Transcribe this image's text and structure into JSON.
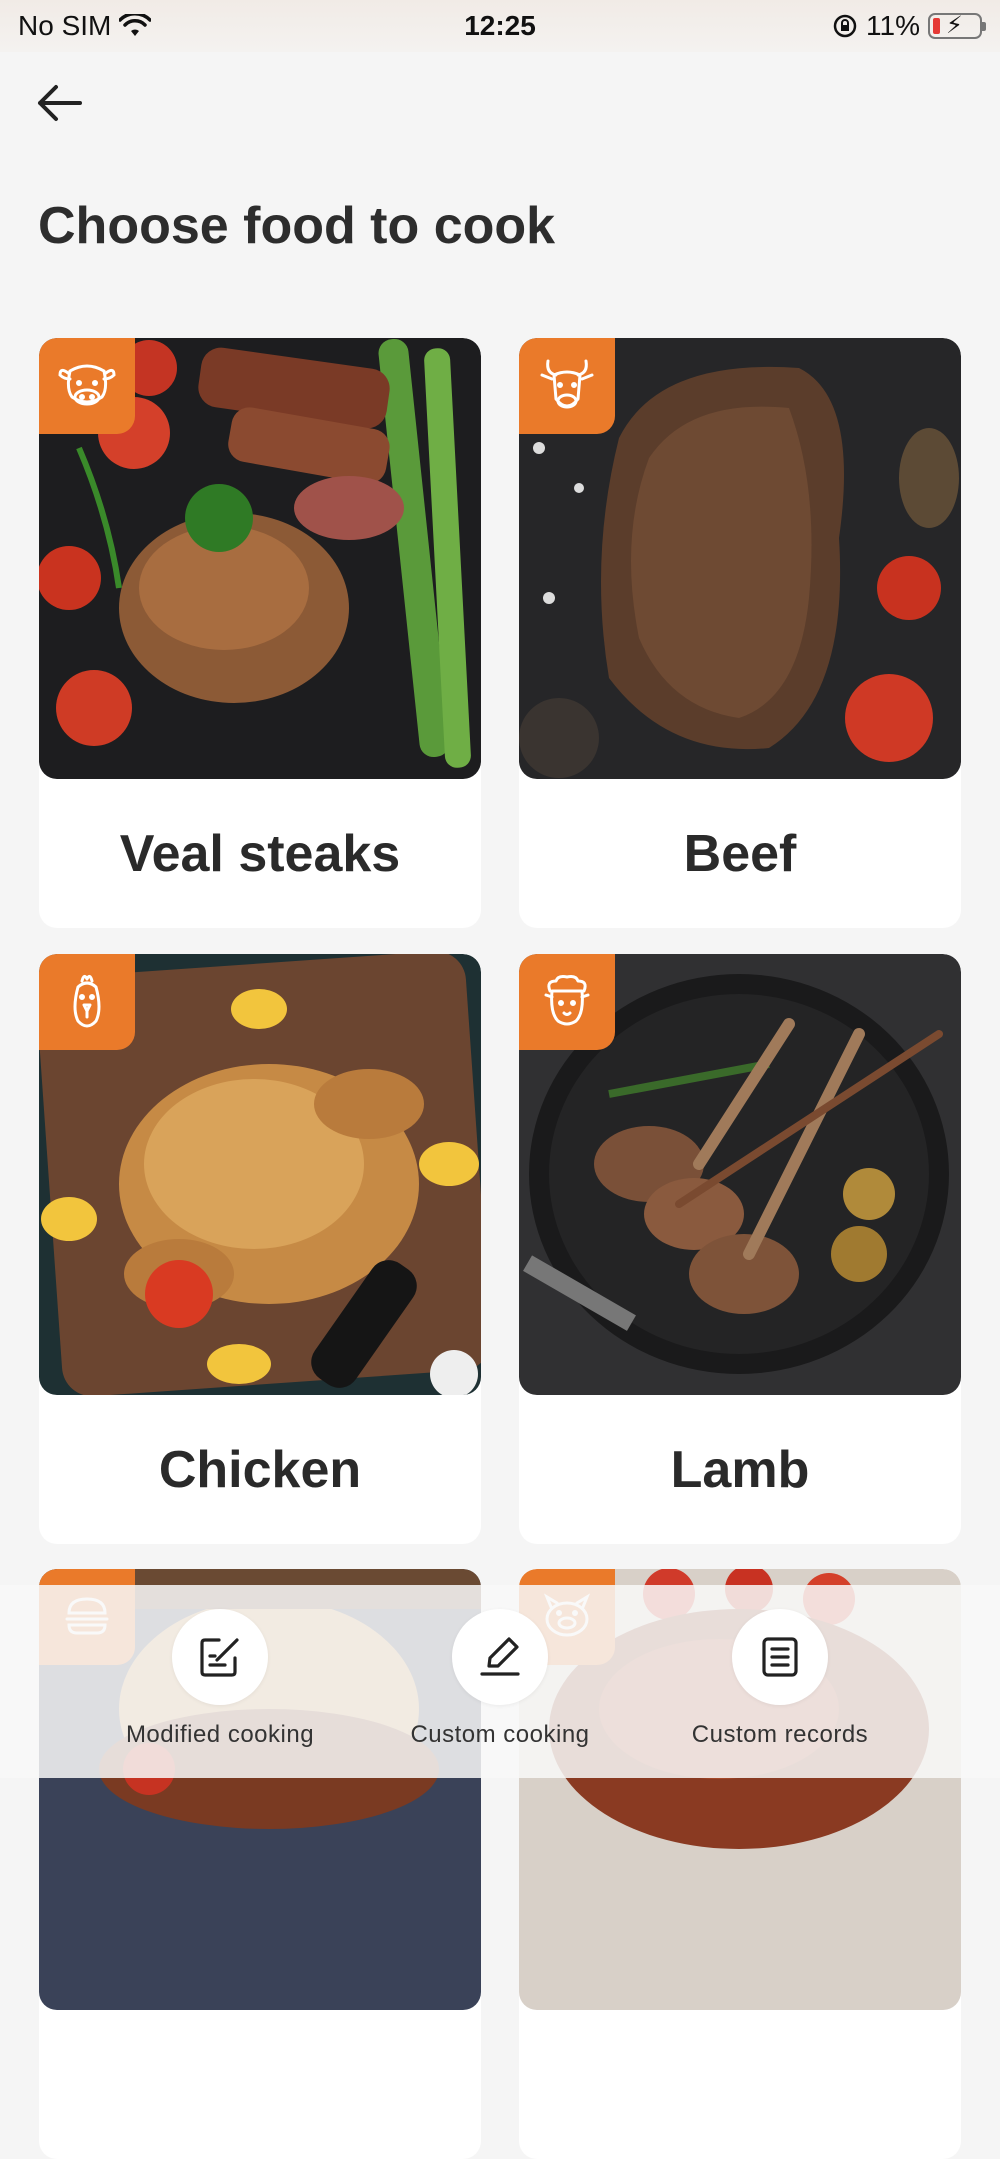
{
  "status_bar": {
    "carrier": "No SIM",
    "time": "12:25",
    "battery": "11%"
  },
  "page": {
    "title": "Choose food to cook"
  },
  "foods": [
    {
      "label": "Veal steaks",
      "badge_icon": "cow-icon"
    },
    {
      "label": "Beef",
      "badge_icon": "bull-icon"
    },
    {
      "label": "Chicken",
      "badge_icon": "chicken-icon"
    },
    {
      "label": "Lamb",
      "badge_icon": "sheep-icon"
    },
    {
      "label": "",
      "badge_icon": "burger-icon"
    },
    {
      "label": "",
      "badge_icon": "pig-icon"
    }
  ],
  "bottom_actions": [
    {
      "label": "Modified cooking",
      "icon": "edit-note-icon"
    },
    {
      "label": "Custom cooking",
      "icon": "pencil-icon"
    },
    {
      "label": "Custom records",
      "icon": "records-icon"
    }
  ],
  "colors": {
    "accent": "#ea7a2a",
    "background": "#f5f5f5"
  }
}
